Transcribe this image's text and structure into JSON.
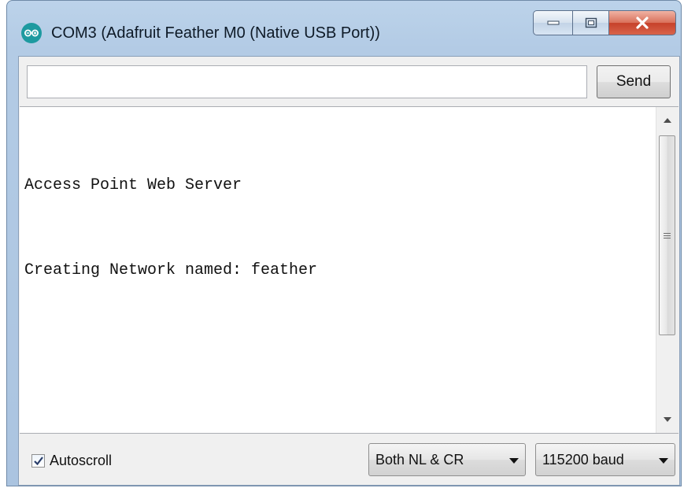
{
  "window": {
    "title": "COM3 (Adafruit Feather M0 (Native USB Port))",
    "app_icon": "arduino-icon",
    "controls": [
      "minimize-icon",
      "maximize-icon",
      "close-icon"
    ]
  },
  "send_bar": {
    "input_value": "",
    "input_placeholder": "",
    "send_label": "Send"
  },
  "serial_output": {
    "lines": [
      "Access Point Web Server",
      "Creating Network named: feather"
    ],
    "scrollbar": {
      "thumb_icon": "grip-icon",
      "up_icon": "up-arrow-icon",
      "down_icon": "down-arrow-icon"
    }
  },
  "bottom": {
    "autoscroll": {
      "label": "Autoscroll",
      "checked": true
    },
    "line_ending": "Both NL & CR",
    "baud_rate": "115200 baud"
  },
  "colors": {
    "title_bar": "#b3cbe5",
    "close_button": "#c6412a",
    "icon_teal": "#1d9aa0"
  }
}
